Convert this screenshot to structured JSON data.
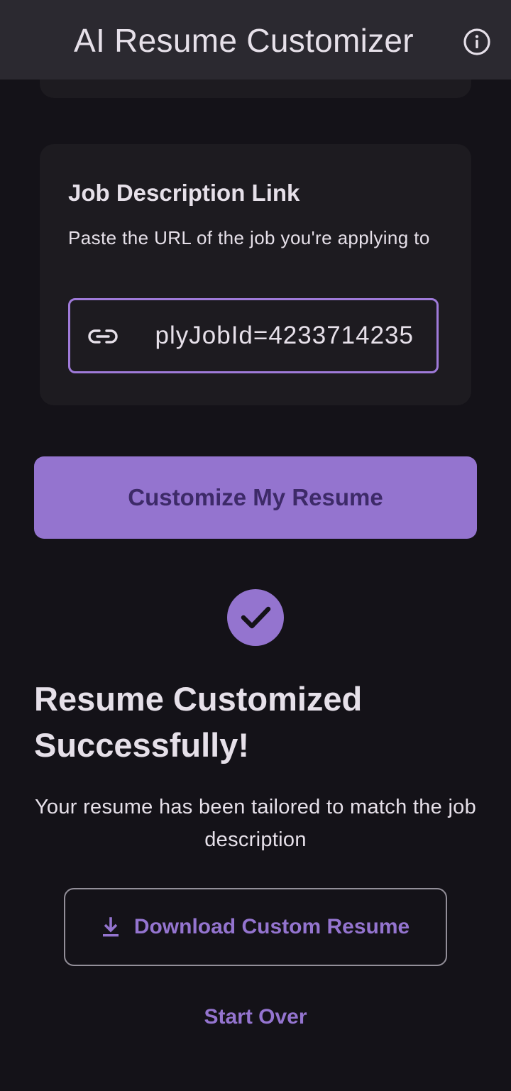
{
  "app_bar": {
    "title": "AI Resume Customizer",
    "info_icon": "info-circle-icon"
  },
  "job_card": {
    "title": "Job Description Link",
    "subtitle": "Paste the URL of the job you're applying to",
    "url_field": {
      "icon": "link-icon",
      "value": "plyJobId=4233714235"
    }
  },
  "primary_button": {
    "label": "Customize My Resume"
  },
  "result": {
    "icon": "check-circle-icon",
    "title": "Resume Customized Successfully!",
    "description": "Your resume has been tailored to match the job description",
    "download_button": {
      "icon": "download-icon",
      "label": "Download Custom Resume"
    },
    "start_over_label": "Start Over"
  },
  "colors": {
    "background": "#141218",
    "app_bar": "#2b2930",
    "card": "#1d1b20",
    "accent": "#9474cf",
    "focus_border": "#9f7ad9",
    "text": "#e6e0e9"
  }
}
